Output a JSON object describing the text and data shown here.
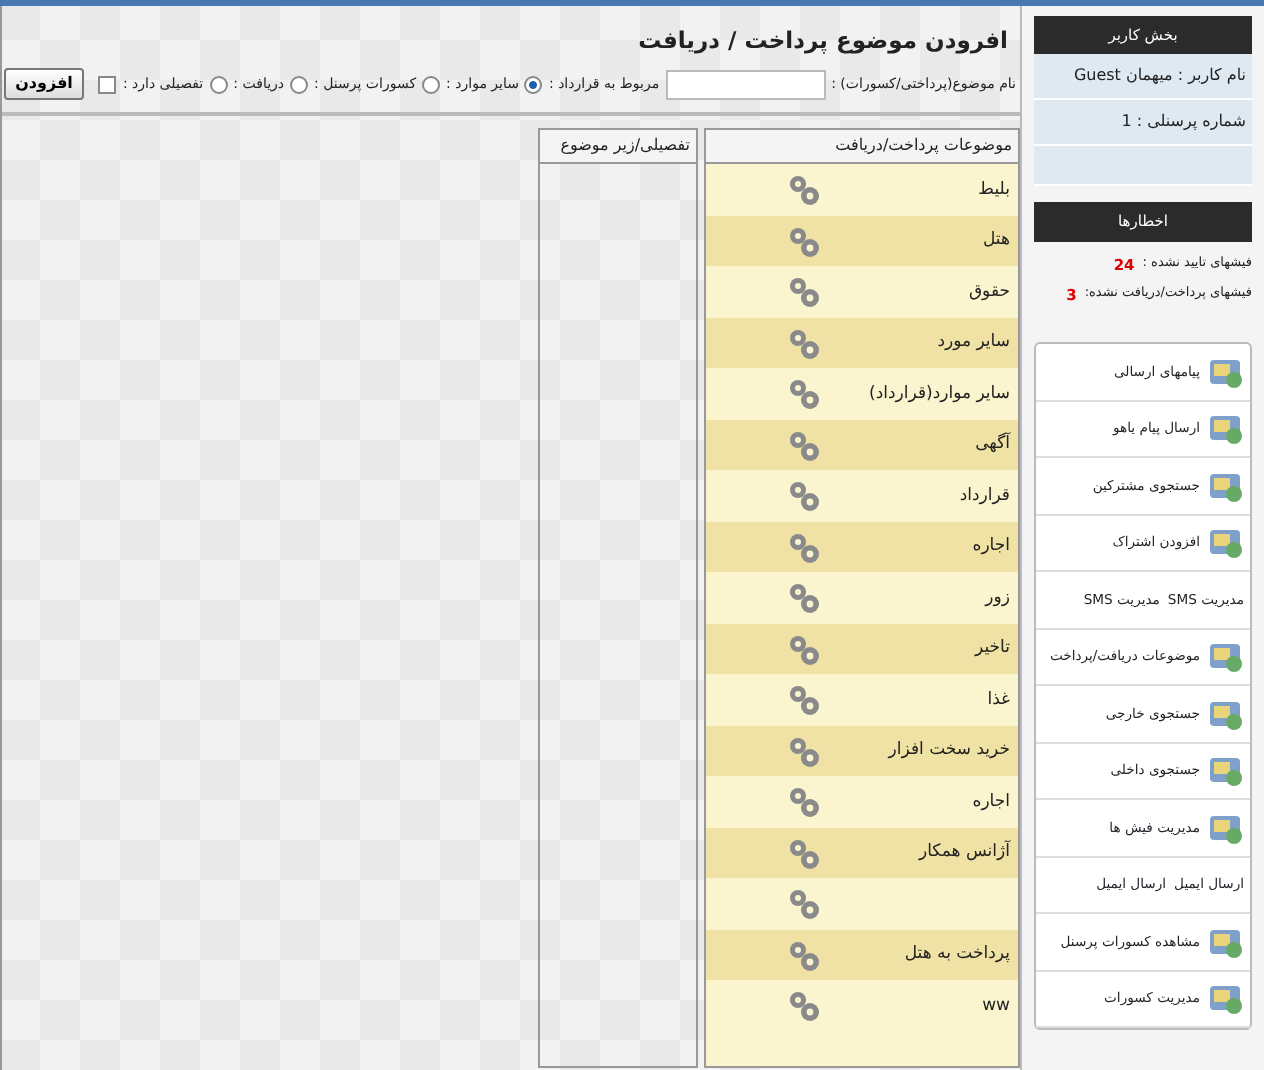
{
  "page": {
    "title": "افرودن موضوع پرداخت / دریافت"
  },
  "form": {
    "name_label": "نام موضوع(پرداختی/کسورات) :",
    "options": [
      {
        "label": "مربوط به قرارداد :",
        "kind": "radio",
        "selected": true
      },
      {
        "label": "سایر موارد :",
        "kind": "radio",
        "selected": false
      },
      {
        "label": "کسورات پرسنل :",
        "kind": "radio",
        "selected": false
      },
      {
        "label": "دریافت :",
        "kind": "radio",
        "selected": false
      },
      {
        "label": "تفصیلی دارد :",
        "kind": "checkbox",
        "checked": false
      }
    ],
    "submit": "افزودن"
  },
  "table": {
    "columns": [
      "موضوعات پرداخت/دریافت",
      "تفصیلی/زیر موضوع"
    ],
    "rows": [
      {
        "name": "بلیط"
      },
      {
        "name": "هتل"
      },
      {
        "name": "حقوق"
      },
      {
        "name": "سایر مورد"
      },
      {
        "name": "سایر موارد(قرارداد)"
      },
      {
        "name": "آگهی"
      },
      {
        "name": "قرارداد"
      },
      {
        "name": "اجاره"
      },
      {
        "name": "زور"
      },
      {
        "name": "تاخیر"
      },
      {
        "name": "غذا"
      },
      {
        "name": "خرید سخت افزار"
      },
      {
        "name": "اجاره"
      },
      {
        "name": "آژانس همکار"
      },
      {},
      {
        "name": "پرداخت به هتل"
      },
      {
        "name": "ww"
      }
    ]
  },
  "sidebar": {
    "user_header": "بخش کاربر",
    "user_name": "نام کاربر : میهمان Guest",
    "personnel_no": "شماره پرسنلی : 1",
    "alerts_header": "اخطارها",
    "alerts": [
      {
        "label": "فیشهای تایید نشده :",
        "count": "24"
      },
      {
        "label": "فیشهای پرداخت/دریافت نشده:",
        "count": "3"
      }
    ],
    "menu": [
      {
        "kind": "icon",
        "label": "پیامهای ارسالی"
      },
      {
        "kind": "icon",
        "label": "ارسال پیام یاهو"
      },
      {
        "kind": "icon",
        "label": "جستجوی مشترکین"
      },
      {
        "kind": "icon",
        "label": "افزودن اشتراک"
      },
      {
        "kind": "text",
        "labels": [
          "مدیریت SMS",
          "مدیریت SMS"
        ]
      },
      {
        "kind": "icon",
        "label": "موضوعات دریافت/پرداخت"
      },
      {
        "kind": "icon",
        "label": "جستجوی خارجی"
      },
      {
        "kind": "icon",
        "label": "جستجوی داخلی"
      },
      {
        "kind": "icon",
        "label": "مدیریت فیش ها"
      },
      {
        "kind": "text",
        "labels": [
          "ارسال ایمیل",
          "ارسال ایمیل"
        ]
      },
      {
        "kind": "icon",
        "label": "مشاهده کسورات پرسنل"
      },
      {
        "kind": "icon",
        "label": "مدیریت کسورات"
      }
    ]
  }
}
